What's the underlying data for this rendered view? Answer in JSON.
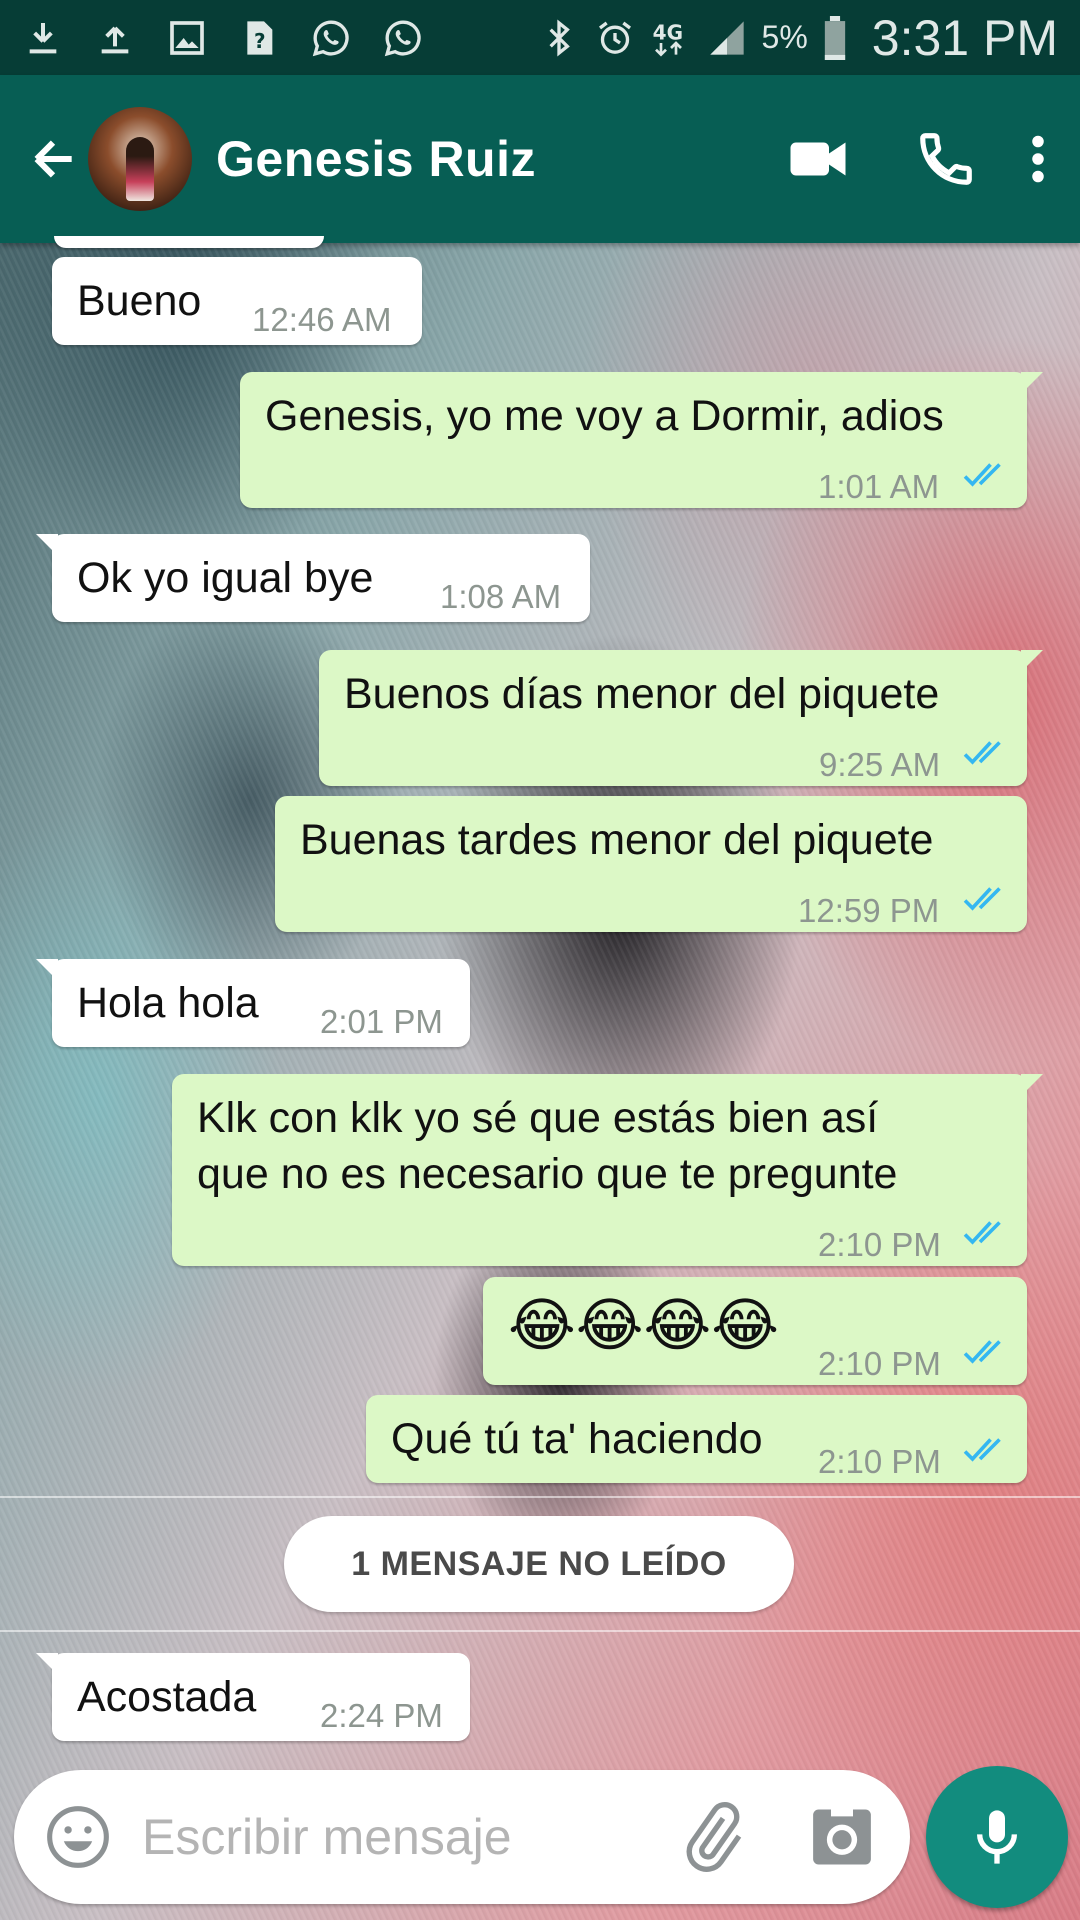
{
  "status_bar": {
    "battery_percent": "5%",
    "time": "3:31 PM",
    "network": "4G"
  },
  "header": {
    "contact_name": "Genesis Ruiz"
  },
  "messages": [
    {
      "direction": "in",
      "text": "Bueno",
      "time": "12:46 AM"
    },
    {
      "direction": "out",
      "text": "Genesis, yo me voy a Dormir, adios",
      "time": "1:01 AM",
      "read": true
    },
    {
      "direction": "in",
      "text": "Ok yo igual bye",
      "time": "1:08 AM"
    },
    {
      "direction": "out",
      "text": "Buenos días menor del piquete",
      "time": "9:25 AM",
      "read": true
    },
    {
      "direction": "out",
      "text": "Buenas tardes menor del piquete",
      "time": "12:59 PM",
      "read": true
    },
    {
      "direction": "in",
      "text": "Hola hola",
      "time": "2:01 PM"
    },
    {
      "direction": "out",
      "text_line1": "Klk con klk yo sé que estás bien así",
      "text_line2": "que no es necesario que te pregunte",
      "time": "2:10 PM",
      "read": true
    },
    {
      "direction": "out",
      "text": "😂😂😂😂",
      "time": "2:10 PM",
      "read": true
    },
    {
      "direction": "out",
      "text": "Qué tú ta' haciendo",
      "time": "2:10 PM",
      "read": true
    },
    {
      "direction": "in",
      "text": "Acostada",
      "time": "2:24 PM"
    }
  ],
  "unread_divider": "1 MENSAJE NO LEÍDO",
  "composer": {
    "placeholder": "Escribir mensaje",
    "value": ""
  },
  "colors": {
    "header": "#075e54",
    "status_bar": "#063d36",
    "outgoing_bubble": "#dcf8c6",
    "incoming_bubble": "#ffffff",
    "read_ticks": "#34b7f1",
    "mic_button": "#128c7e"
  },
  "icons": {
    "status": [
      "download-icon",
      "upload-icon",
      "image-icon",
      "file-icon",
      "whatsapp-icon",
      "whatsapp-icon",
      "bluetooth-icon",
      "alarm-icon",
      "signal-icon",
      "battery-icon"
    ],
    "header": [
      "back-arrow-icon",
      "video-call-icon",
      "phone-icon",
      "more-vert-icon"
    ],
    "composer": [
      "emoji-icon",
      "attach-icon",
      "camera-icon",
      "mic-icon"
    ]
  }
}
